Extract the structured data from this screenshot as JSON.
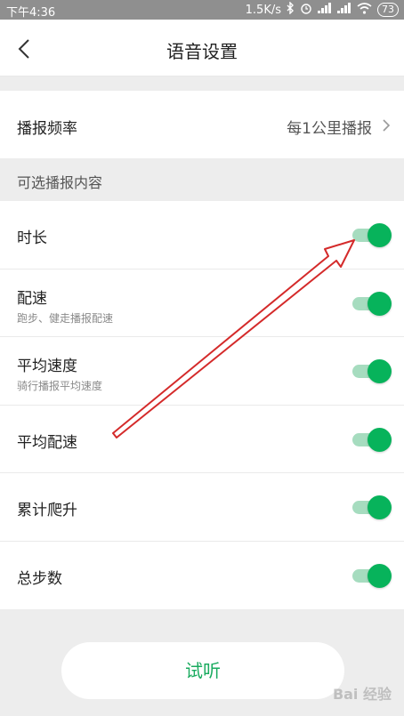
{
  "status_bar": {
    "time": "下午4:36",
    "network_speed": "1.5K/s",
    "battery": "73"
  },
  "nav": {
    "title": "语音设置"
  },
  "frequency": {
    "label": "播报频率",
    "value": "每1公里播报"
  },
  "section": {
    "header": "可选播报内容"
  },
  "items": [
    {
      "label": "时长",
      "sub": "",
      "enabled": true
    },
    {
      "label": "配速",
      "sub": "跑步、健走播报配速",
      "enabled": true
    },
    {
      "label": "平均速度",
      "sub": "骑行播报平均速度",
      "enabled": true
    },
    {
      "label": "平均配速",
      "sub": "",
      "enabled": true
    },
    {
      "label": "累计爬升",
      "sub": "",
      "enabled": true
    },
    {
      "label": "总步数",
      "sub": "",
      "enabled": true
    }
  ],
  "listen_button": {
    "label": "试听"
  },
  "colors": {
    "accent": "#07b35b",
    "toggle_track": "#a6dcbf",
    "annotation": "#d42a2a"
  }
}
